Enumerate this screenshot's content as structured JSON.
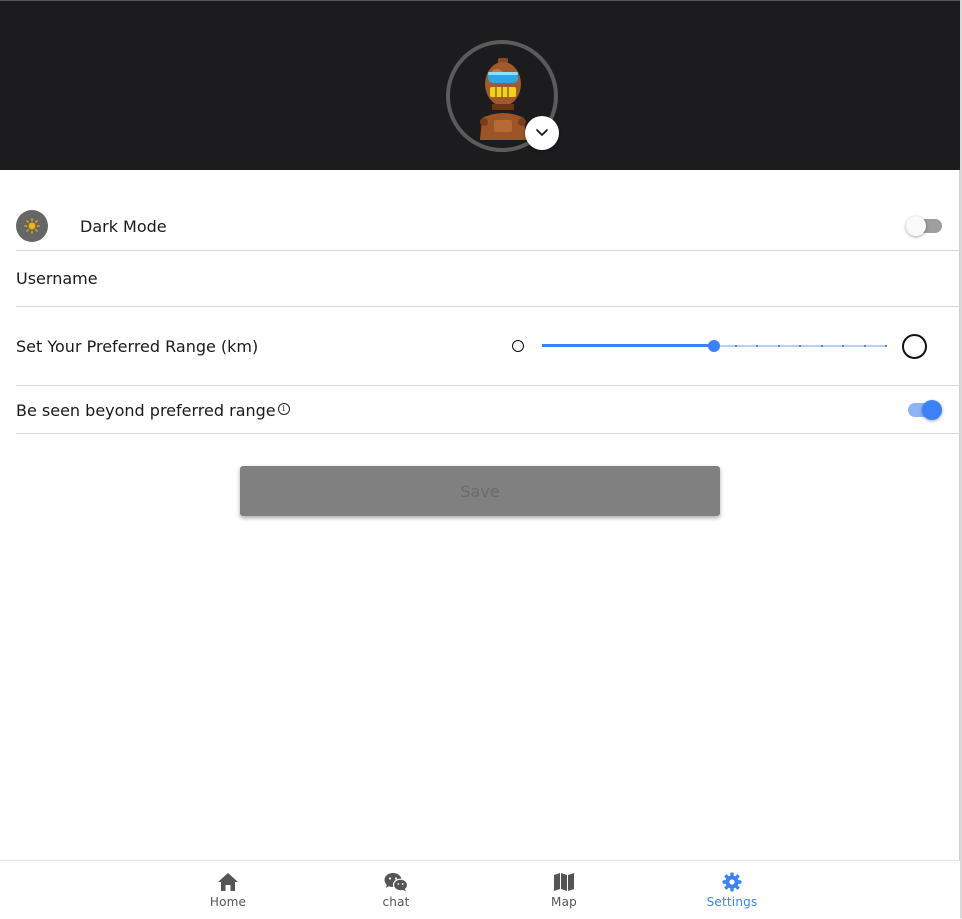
{
  "profile": {
    "avatar_icon": "robot-avatar",
    "menu_icon": "chevron-down-icon"
  },
  "settings": {
    "dark_mode": {
      "label": "Dark Mode",
      "icon": "sun-icon",
      "enabled": false
    },
    "username": {
      "label": "Username"
    },
    "range": {
      "label": "Set Your Preferred Range (km)",
      "min_icon": "small-circle-icon",
      "max_icon": "large-circle-icon",
      "value_fraction": 0.5,
      "steps": 16
    },
    "visibility": {
      "label": "Be seen beyond preferred range",
      "info_icon": "info-icon",
      "enabled": true
    },
    "save_label": "Save"
  },
  "nav": {
    "items": [
      {
        "label": "Home",
        "icon": "home-icon",
        "active": false
      },
      {
        "label": "chat",
        "icon": "wechat-icon",
        "active": false
      },
      {
        "label": "Map",
        "icon": "map-icon",
        "active": false
      },
      {
        "label": "Settings",
        "icon": "gear-icon",
        "active": true
      }
    ]
  },
  "colors": {
    "accent": "#3b82f6",
    "header_bg": "#1c1c1e",
    "nav_inactive": "#555555",
    "save_bg": "#808080"
  }
}
